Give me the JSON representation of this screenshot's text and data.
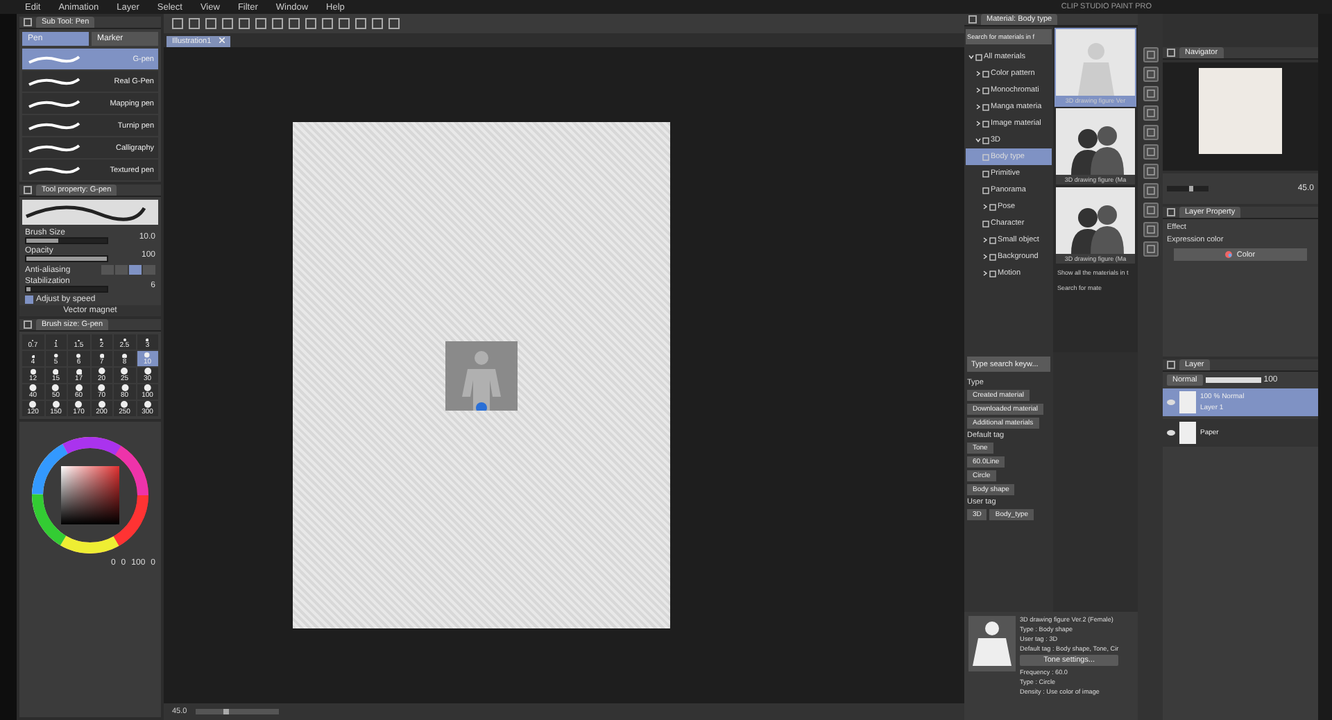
{
  "window": {
    "title": "CLIP STUDIO PAINT PRO"
  },
  "menu": [
    "Edit",
    "Animation",
    "Layer",
    "Select",
    "View",
    "Filter",
    "Window",
    "Help"
  ],
  "canvas_tab": {
    "label": "Illustration1"
  },
  "sub_tool": {
    "title": "Sub Tool: Pen",
    "tabs": [
      {
        "label": "Pen",
        "selected": true
      },
      {
        "label": "Marker",
        "selected": false
      }
    ],
    "brushes": [
      {
        "label": "G-pen",
        "selected": true
      },
      {
        "label": "Real G-Pen",
        "selected": false
      },
      {
        "label": "Mapping pen",
        "selected": false
      },
      {
        "label": "Turnip pen",
        "selected": false
      },
      {
        "label": "Calligraphy",
        "selected": false
      },
      {
        "label": "Textured pen",
        "selected": false
      }
    ]
  },
  "tool_property": {
    "title": "Tool property: G-pen",
    "settings": [
      {
        "kind": "slider",
        "label": "Brush Size",
        "value": "10.0",
        "level": 0.4
      },
      {
        "kind": "slider",
        "label": "Opacity",
        "value": "100",
        "level": 1
      },
      {
        "kind": "choice",
        "label": "Anti-aliasing",
        "options": [
          {
            "selected": false
          },
          {
            "selected": false
          },
          {
            "selected": true
          },
          {
            "selected": false
          }
        ]
      },
      {
        "kind": "slider",
        "label": "Stabilization",
        "value": "6",
        "level": 0.06
      },
      {
        "kind": "checkbox",
        "label": "Adjust by speed",
        "checked": true
      },
      {
        "kind": "link",
        "label": "Vector magnet"
      }
    ]
  },
  "brush_size": {
    "title": "Brush size: G-pen",
    "sizes": [
      {
        "label": "0.7",
        "selected": false
      },
      {
        "label": "1",
        "selected": false
      },
      {
        "label": "1.5",
        "selected": false
      },
      {
        "label": "2",
        "selected": false
      },
      {
        "label": "2.5",
        "selected": false
      },
      {
        "label": "3",
        "selected": false
      },
      {
        "label": "4",
        "selected": false
      },
      {
        "label": "5",
        "selected": false
      },
      {
        "label": "6",
        "selected": false
      },
      {
        "label": "7",
        "selected": false
      },
      {
        "label": "8",
        "selected": false
      },
      {
        "label": "10",
        "selected": true
      },
      {
        "label": "12",
        "selected": false
      },
      {
        "label": "15",
        "selected": false
      },
      {
        "label": "17",
        "selected": false
      },
      {
        "label": "20",
        "selected": false
      },
      {
        "label": "25",
        "selected": false
      },
      {
        "label": "30",
        "selected": false
      },
      {
        "label": "40",
        "selected": false
      },
      {
        "label": "50",
        "selected": false
      },
      {
        "label": "60",
        "selected": false
      },
      {
        "label": "70",
        "selected": false
      },
      {
        "label": "80",
        "selected": false
      },
      {
        "label": "100",
        "selected": false
      },
      {
        "label": "120",
        "selected": false
      },
      {
        "label": "150",
        "selected": false
      },
      {
        "label": "170",
        "selected": false
      },
      {
        "label": "200",
        "selected": false
      },
      {
        "label": "250",
        "selected": false
      },
      {
        "label": "300",
        "selected": false
      }
    ]
  },
  "color": {
    "readout": [
      "0",
      "0",
      "100",
      "0"
    ]
  },
  "status_bar": {
    "zoom": "45.0"
  },
  "material": {
    "title": "Material: Body type",
    "search": {
      "placeholder": "Search for materials in f"
    },
    "tree": [
      {
        "label": "All materials",
        "expanded": true,
        "selected": false,
        "children": [
          {
            "label": "Color pattern",
            "expanded": false,
            "selected": false
          },
          {
            "label": "Monochromati",
            "expanded": false,
            "selected": false
          },
          {
            "label": "Manga materia",
            "expanded": false,
            "selected": false
          },
          {
            "label": "Image material",
            "expanded": false,
            "selected": false
          },
          {
            "label": "3D",
            "expanded": true,
            "selected": false,
            "children": [
              {
                "label": "Body type",
                "selected": true
              },
              {
                "label": "Primitive",
                "selected": false
              },
              {
                "label": "Panorama",
                "selected": false
              },
              {
                "label": "Pose",
                "expanded": false,
                "selected": false
              },
              {
                "label": "Character",
                "selected": false
              },
              {
                "label": "Small object",
                "expanded": false,
                "selected": false
              },
              {
                "label": "Background",
                "expanded": false,
                "selected": false
              },
              {
                "label": "Motion",
                "expanded": false,
                "selected": false
              }
            ]
          }
        ]
      }
    ],
    "thumbnails": [
      {
        "caption": "3D drawing figure Ver",
        "kind": "figure",
        "selected": true
      },
      {
        "caption": "3D drawing figure (Ma",
        "kind": "pair",
        "selected": false
      },
      {
        "caption": "3D drawing figure (Ma",
        "kind": "pair",
        "selected": false
      }
    ],
    "show_all": "Show all the materials in t",
    "search_link": "Search for mate"
  },
  "tag_search": {
    "placeholder": "Type search keyw..."
  },
  "tag_groups": [
    {
      "heading": "Type",
      "tags": [
        "Created material",
        "Downloaded material",
        "Additional materials"
      ]
    },
    {
      "heading": "Default tag",
      "tags": [
        "Tone",
        "60.0Line",
        "Circle",
        "Body shape"
      ]
    },
    {
      "heading": "User tag",
      "tags": [
        "3D",
        "Body_type"
      ]
    }
  ],
  "detail": {
    "lines": [
      "3D drawing figure Ver.2 (Female)",
      "Type : Body shape",
      "User tag : 3D",
      "Default tag : Body shape, Tone, Cir"
    ],
    "button": "Tone settings...",
    "more_lines": [
      "Frequency : 60.0",
      "Type : Circle",
      "Density : Use color of image"
    ]
  },
  "navigator": {
    "title": "Navigator",
    "zoom": "45.0"
  },
  "layer_property": {
    "title": "Layer Property",
    "effect_label": "Effect",
    "expression_label": "Expression color",
    "expression_value": "Color"
  },
  "layer_panel": {
    "title": "Layer",
    "blend_mode": "Normal",
    "opacity": "100",
    "layers": [
      {
        "name": "Layer 1",
        "info": "100 % Normal",
        "selected": true
      },
      {
        "name": "Paper",
        "selected": false
      }
    ]
  }
}
